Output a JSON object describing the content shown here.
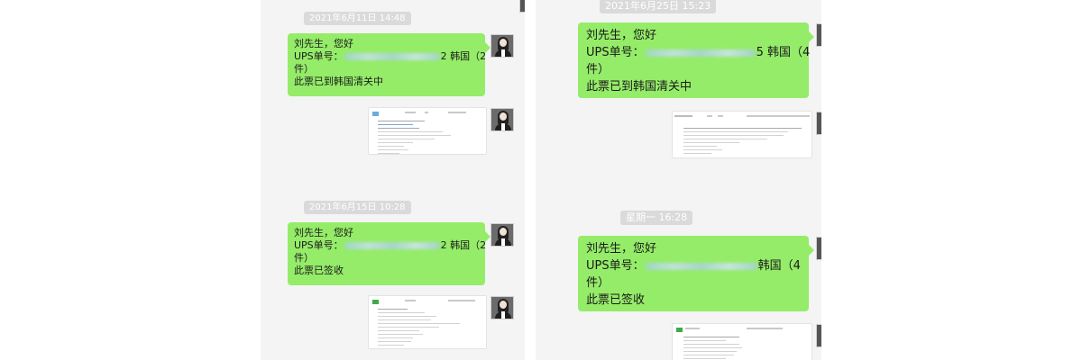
{
  "left_chat": {
    "timestamp_1": "2021年6月11日 14:48",
    "msg_1": {
      "line_1": "刘先生，您好",
      "line_2_prefix": "UPS单号：",
      "line_2_suffix": "2 韩国（2",
      "line_3": "件）",
      "line_4": "此票已到韩国清关中"
    },
    "timestamp_2": "2021年6月15日 10:28",
    "msg_2": {
      "line_1": "刘先生，您好",
      "line_2_prefix": "UPS单号：",
      "line_2_suffix": "2 韩国（2",
      "line_3": "件）",
      "line_4": "此票已签收"
    }
  },
  "right_chat": {
    "timestamp_1": "2021年6月25日 15:23",
    "msg_1": {
      "line_1": "刘先生，您好",
      "line_2_prefix": "UPS单号：",
      "line_2_suffix": "5 韩国（4",
      "line_3": "件）",
      "line_4": "此票已到韩国清关中"
    },
    "timestamp_2": "星期一 16:28",
    "msg_2": {
      "line_1": "刘先生，您好",
      "line_2_prefix": "UPS单号：",
      "line_2_suffix": "韩国（4",
      "line_3": "件）",
      "line_4": "此票已签收"
    }
  },
  "colors": {
    "bubble_green": "#95ec69",
    "panel_bg": "#f4f4f4",
    "timestamp_bg": "#dadada"
  },
  "icons": {
    "avatar": "sender-avatar",
    "attachment": "document-screenshot"
  }
}
